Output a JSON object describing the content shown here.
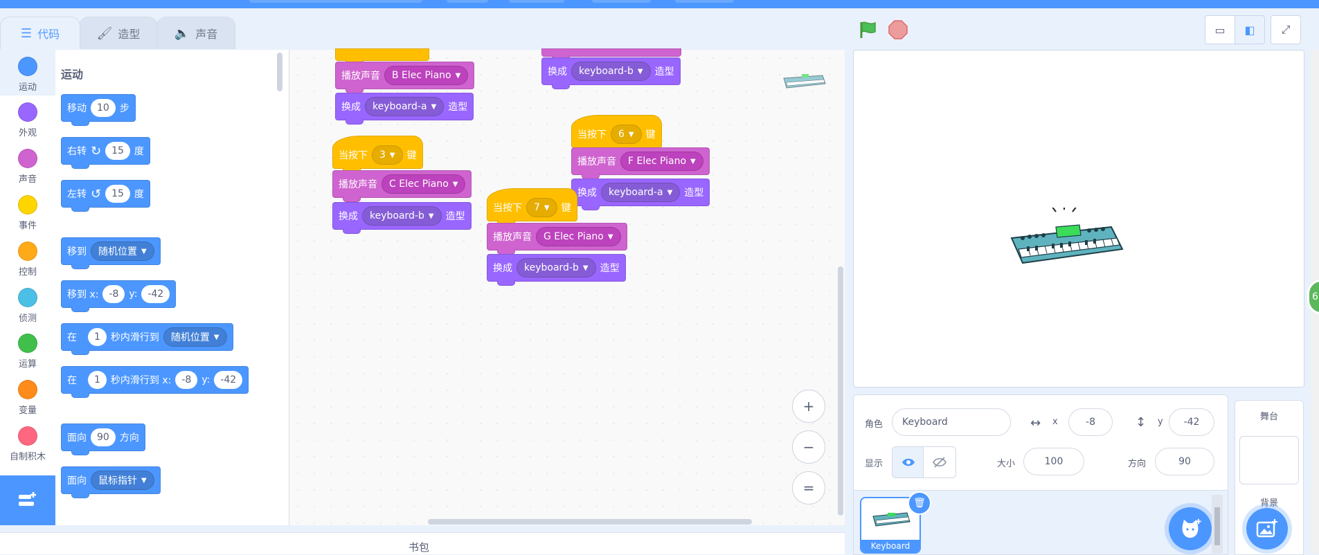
{
  "tabs": [
    {
      "label": "代码",
      "icon": "code-icon"
    },
    {
      "label": "造型",
      "icon": "brush-icon"
    },
    {
      "label": "声音",
      "icon": "speaker-icon"
    }
  ],
  "categories": [
    {
      "label": "运动",
      "color": "#4c97ff"
    },
    {
      "label": "外观",
      "color": "#9966ff"
    },
    {
      "label": "声音",
      "color": "#cf63cf"
    },
    {
      "label": "事件",
      "color": "#ffd500"
    },
    {
      "label": "控制",
      "color": "#ffab19"
    },
    {
      "label": "侦测",
      "color": "#4cbfe6"
    },
    {
      "label": "运算",
      "color": "#40bf4a"
    },
    {
      "label": "变量",
      "color": "#ff8c1a"
    },
    {
      "label": "自制积木",
      "color": "#ff6680"
    }
  ],
  "palette": {
    "title": "运动",
    "move": {
      "label": "移动",
      "value": "10",
      "suffix": "步"
    },
    "turn_right": {
      "label": "右转",
      "value": "15",
      "suffix": "度"
    },
    "turn_left": {
      "label": "左转",
      "value": "15",
      "suffix": "度"
    },
    "goto": {
      "label": "移到",
      "option": "随机位置"
    },
    "goto_xy": {
      "label": "移到 x:",
      "x": "-8",
      "ylabel": "y:",
      "y": "-42"
    },
    "glide": {
      "prefix": "在",
      "secs": "1",
      "label": "秒内滑行到",
      "option": "随机位置"
    },
    "glide_xy": {
      "prefix": "在",
      "secs": "1",
      "label": "秒内滑行到 x:",
      "x": "-8",
      "ylabel": "y:",
      "y": "-42"
    },
    "point_dir": {
      "label": "面向",
      "value": "90",
      "suffix": "方向"
    },
    "point_towards": {
      "label": "面向",
      "option": "鼠标指针"
    }
  },
  "script_blocks": {
    "play_label": "播放声音",
    "switch_label": "换成",
    "costume_suffix": "造型",
    "when_label": "当按下",
    "key_suffix": "键",
    "s1_play": "B Elec Piano",
    "s1_costume": "keyboard-a",
    "s2_costume": "keyboard-b",
    "s3_key": "3",
    "s3_play": "C Elec Piano",
    "s3_costume": "keyboard-b",
    "s4_key": "6",
    "s4_play": "F Elec Piano",
    "s4_costume": "keyboard-a",
    "s5_key": "7",
    "s5_play": "G Elec Piano",
    "s5_costume": "keyboard-b"
  },
  "zoom": {
    "in": "+",
    "out": "−",
    "reset": "="
  },
  "backpack": {
    "label": "书包"
  },
  "sprite_info": {
    "sprite_label": "角色",
    "sprite_name": "Keyboard",
    "x_label": "x",
    "x_value": "-8",
    "y_label": "y",
    "y_value": "-42",
    "show_label": "显示",
    "size_label": "大小",
    "size_value": "100",
    "direction_label": "方向",
    "direction_value": "90"
  },
  "sprite_list": [
    {
      "name": "Keyboard"
    }
  ],
  "stage_panel": {
    "title": "舞台",
    "backdrops_label": "背景"
  },
  "edge_badge": "6",
  "colors": {
    "motion": "#4c97ff",
    "looks": "#9966ff",
    "sound": "#cf63cf",
    "events": "#ffbf00",
    "accent": "#4c97ff"
  }
}
